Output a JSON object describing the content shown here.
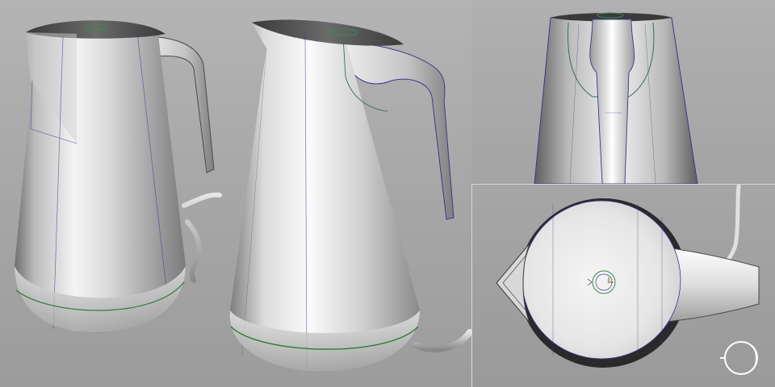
{
  "scene": {
    "viewports": [
      {
        "id": "perspective",
        "content": "kettle-perspective-views"
      },
      {
        "id": "front",
        "content": "kettle-front-view"
      },
      {
        "id": "top",
        "content": "kettle-top-view"
      }
    ],
    "colors": {
      "background_light": "#b4b4b4",
      "background_dark": "#9a9a9a",
      "body_highlight": "#f2f2f2",
      "body_shadow": "#7a7a7a",
      "isocurve_blue": "#3a3a8c",
      "isocurve_green": "#2f7a3a",
      "dark_rim": "#2a2a2a"
    },
    "icons": {
      "view_cube": "view-cube-icon"
    }
  }
}
